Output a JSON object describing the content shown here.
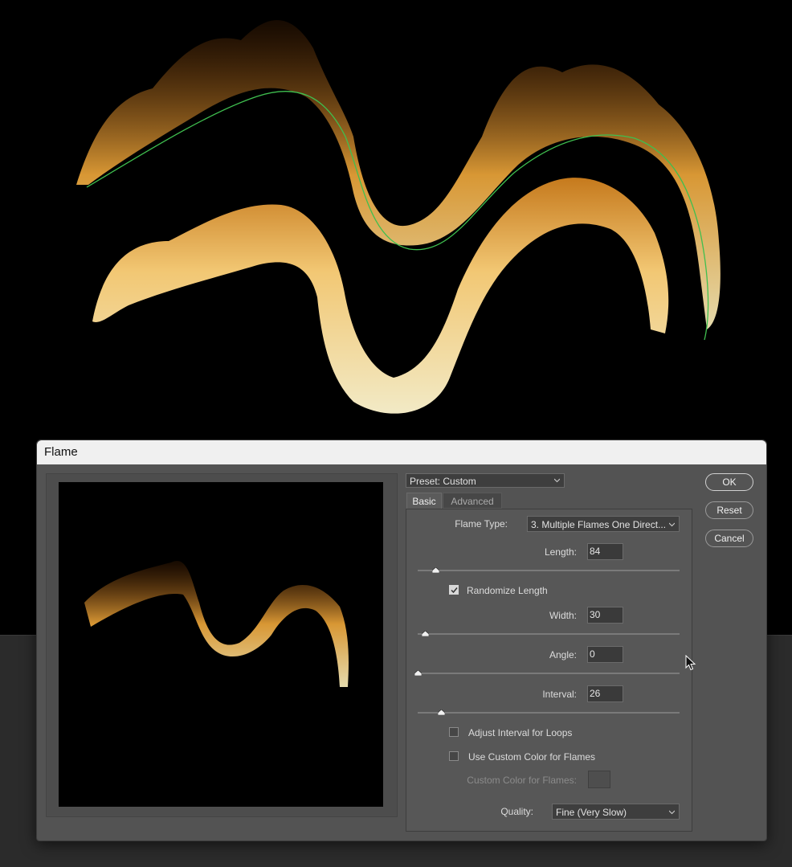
{
  "dialog": {
    "title": "Flame",
    "preset": {
      "label": "Preset: Custom"
    },
    "tabs": [
      {
        "label": "Basic",
        "selected": true
      },
      {
        "label": "Advanced",
        "selected": false
      }
    ],
    "basic": {
      "flame_type": {
        "label": "Flame Type:",
        "value": "3. Multiple Flames One Direct..."
      },
      "length": {
        "label": "Length:",
        "value": "84",
        "slider_fraction": 0.07
      },
      "randomize_length": {
        "label": "Randomize Length",
        "checked": true
      },
      "width": {
        "label": "Width:",
        "value": "30",
        "slider_fraction": 0.03
      },
      "angle": {
        "label": "Angle:",
        "value": "0",
        "slider_fraction": 0.0
      },
      "interval": {
        "label": "Interval:",
        "value": "26",
        "slider_fraction": 0.09
      },
      "adjust_interval": {
        "label": "Adjust Interval for Loops",
        "checked": false
      },
      "custom_color": {
        "label": "Use Custom Color for Flames",
        "checked": false
      },
      "custom_color_swatch": {
        "label": "Custom Color for Flames:"
      },
      "quality": {
        "label": "Quality:",
        "value": "Fine (Very Slow)"
      }
    },
    "buttons": {
      "ok": "OK",
      "reset": "Reset",
      "cancel": "Cancel"
    }
  },
  "colors": {
    "dialog_bg": "#535353",
    "flame_core": "#ffe8a0",
    "flame_outer": "#e08a20",
    "path_stroke": "#3fbf4f"
  },
  "icons": {
    "select_caret": "chevron-down-icon",
    "checkmark": "check-icon",
    "cursor": "arrow-cursor-icon"
  }
}
